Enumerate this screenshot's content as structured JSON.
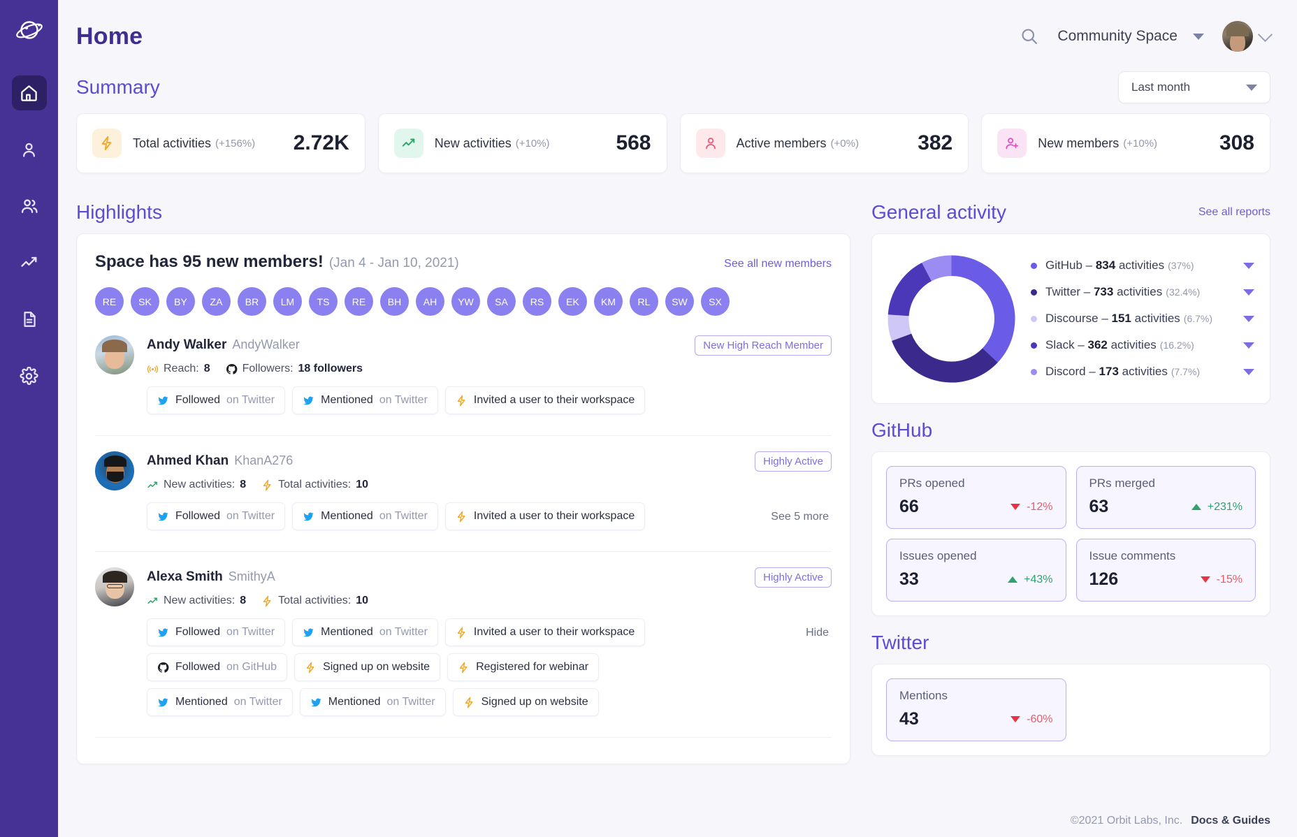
{
  "sidebar": {
    "logo_icon": "orbit-logo-icon",
    "items": [
      {
        "icon": "home-icon",
        "name": "home",
        "active": true
      },
      {
        "icon": "person-icon",
        "name": "member",
        "active": false
      },
      {
        "icon": "people-icon",
        "name": "members",
        "active": false
      },
      {
        "icon": "trending-up-icon",
        "name": "reports",
        "active": false
      },
      {
        "icon": "document-icon",
        "name": "content",
        "active": false
      },
      {
        "icon": "gear-icon",
        "name": "settings",
        "active": false
      }
    ]
  },
  "header": {
    "title": "Home",
    "search_icon": "search-icon",
    "space_name": "Community Space",
    "space_caret_icon": "chevron-down-icon",
    "avatar_icon": "avatar",
    "avatar_caret_icon": "chevron-down-icon"
  },
  "summary": {
    "heading": "Summary",
    "filter": {
      "value": "Last month",
      "caret_icon": "chevron-down-icon"
    },
    "cards": [
      {
        "icon": "lightning-icon",
        "label": "Total activities",
        "delta": "(+156%)",
        "value": "2.72K",
        "icon_bg": "#fdf1dc",
        "icon_color": "#f0a92b"
      },
      {
        "icon": "trend-icon",
        "label": "New activities",
        "delta": "(+10%)",
        "value": "568",
        "icon_bg": "#e1f6ec",
        "icon_color": "#2fa36b"
      },
      {
        "icon": "person-icon",
        "label": "Active members",
        "delta": "(+0%)",
        "value": "382",
        "icon_bg": "#fde8ec",
        "icon_color": "#ec5d78"
      },
      {
        "icon": "person-plus-icon",
        "label": "New members",
        "delta": "(+10%)",
        "value": "308",
        "icon_bg": "#fbe3f6",
        "icon_color": "#e053c0"
      }
    ]
  },
  "highlights": {
    "heading": "Highlights",
    "title": "Space has 95 new members!",
    "date_range": "(Jan 4 - Jan 10, 2021)",
    "see_all_label": "See all new members",
    "initials": [
      "RE",
      "SK",
      "BY",
      "ZA",
      "BR",
      "LM",
      "TS",
      "RE",
      "BH",
      "AH",
      "YW",
      "SA",
      "RS",
      "EK",
      "KM",
      "RL",
      "SW",
      "SX"
    ],
    "members": [
      {
        "name": "Andy Walker",
        "handle": "AndyWalker",
        "badge": "New High Reach Member",
        "stats": [
          {
            "icon": "reach-icon",
            "label": "Reach:",
            "value": "8"
          },
          {
            "icon": "github-icon",
            "label": "Followers:",
            "value": "18 followers"
          }
        ],
        "side_action": "",
        "activity_rows": [
          [
            {
              "icon": "twitter-icon",
              "action": "Followed",
              "suffix": "on Twitter"
            },
            {
              "icon": "twitter-icon",
              "action": "Mentioned",
              "suffix": "on Twitter"
            },
            {
              "icon": "lightning-icon",
              "action": "Invited a user to their workspace",
              "suffix": ""
            }
          ]
        ]
      },
      {
        "name": "Ahmed Khan",
        "handle": "KhanA276",
        "badge": "Highly Active",
        "stats": [
          {
            "icon": "trend-icon",
            "label": "New activities:",
            "value": "8"
          },
          {
            "icon": "lightning-icon",
            "label": "Total activities:",
            "value": "10"
          }
        ],
        "side_action": "See 5 more",
        "activity_rows": [
          [
            {
              "icon": "twitter-icon",
              "action": "Followed",
              "suffix": "on Twitter"
            },
            {
              "icon": "twitter-icon",
              "action": "Mentioned",
              "suffix": "on Twitter"
            },
            {
              "icon": "lightning-icon",
              "action": "Invited a user to their workspace",
              "suffix": ""
            }
          ]
        ]
      },
      {
        "name": "Alexa Smith",
        "handle": "SmithyA",
        "badge": "Highly Active",
        "stats": [
          {
            "icon": "trend-icon",
            "label": "New activities:",
            "value": "8"
          },
          {
            "icon": "lightning-icon",
            "label": "Total activities:",
            "value": "10"
          }
        ],
        "side_action": "Hide",
        "activity_rows": [
          [
            {
              "icon": "twitter-icon",
              "action": "Followed",
              "suffix": "on Twitter"
            },
            {
              "icon": "twitter-icon",
              "action": "Mentioned",
              "suffix": "on Twitter"
            },
            {
              "icon": "lightning-icon",
              "action": "Invited a user to their workspace",
              "suffix": ""
            }
          ],
          [
            {
              "icon": "github-icon",
              "action": "Followed",
              "suffix": "on GitHub"
            },
            {
              "icon": "lightning-icon",
              "action": "Signed up on website",
              "suffix": ""
            },
            {
              "icon": "lightning-icon",
              "action": "Registered for webinar",
              "suffix": ""
            }
          ],
          [
            {
              "icon": "twitter-icon",
              "action": "Mentioned",
              "suffix": "on Twitter"
            },
            {
              "icon": "twitter-icon",
              "action": "Mentioned",
              "suffix": "on Twitter"
            },
            {
              "icon": "lightning-icon",
              "action": "Signed up on website",
              "suffix": ""
            }
          ]
        ]
      }
    ]
  },
  "general_activity": {
    "heading": "General activity",
    "see_all_label": "See all reports"
  },
  "chart_data": {
    "type": "pie",
    "title": "General activity",
    "categories": [
      "GitHub",
      "Twitter",
      "Discourse",
      "Slack",
      "Discord"
    ],
    "values": [
      834,
      733,
      151,
      362,
      173
    ],
    "percents": [
      "37%",
      "32.4%",
      "6.7%",
      "16.2%",
      "7.7%"
    ],
    "percent_numbers": [
      37,
      32.4,
      6.7,
      16.2,
      7.7
    ],
    "colors": [
      "#6b5ce7",
      "#3b2a8c",
      "#cfc8f7",
      "#4b38b8",
      "#9a8cf2"
    ],
    "unit_label": "activities",
    "legend_position": "right",
    "donut": true
  },
  "github": {
    "heading": "GitHub",
    "stats": [
      {
        "label": "PRs opened",
        "value": "66",
        "change": "-12%",
        "direction": "down"
      },
      {
        "label": "PRs merged",
        "value": "63",
        "change": "+231%",
        "direction": "up"
      },
      {
        "label": "Issues opened",
        "value": "33",
        "change": "+43%",
        "direction": "up"
      },
      {
        "label": "Issue comments",
        "value": "126",
        "change": "-15%",
        "direction": "down"
      }
    ]
  },
  "twitter": {
    "heading": "Twitter",
    "stats": [
      {
        "label": "Mentions",
        "value": "43",
        "change": "-60%",
        "direction": "down"
      }
    ]
  },
  "footer": {
    "copyright": "©2021 Orbit Labs, Inc.",
    "link": "Docs & Guides"
  }
}
